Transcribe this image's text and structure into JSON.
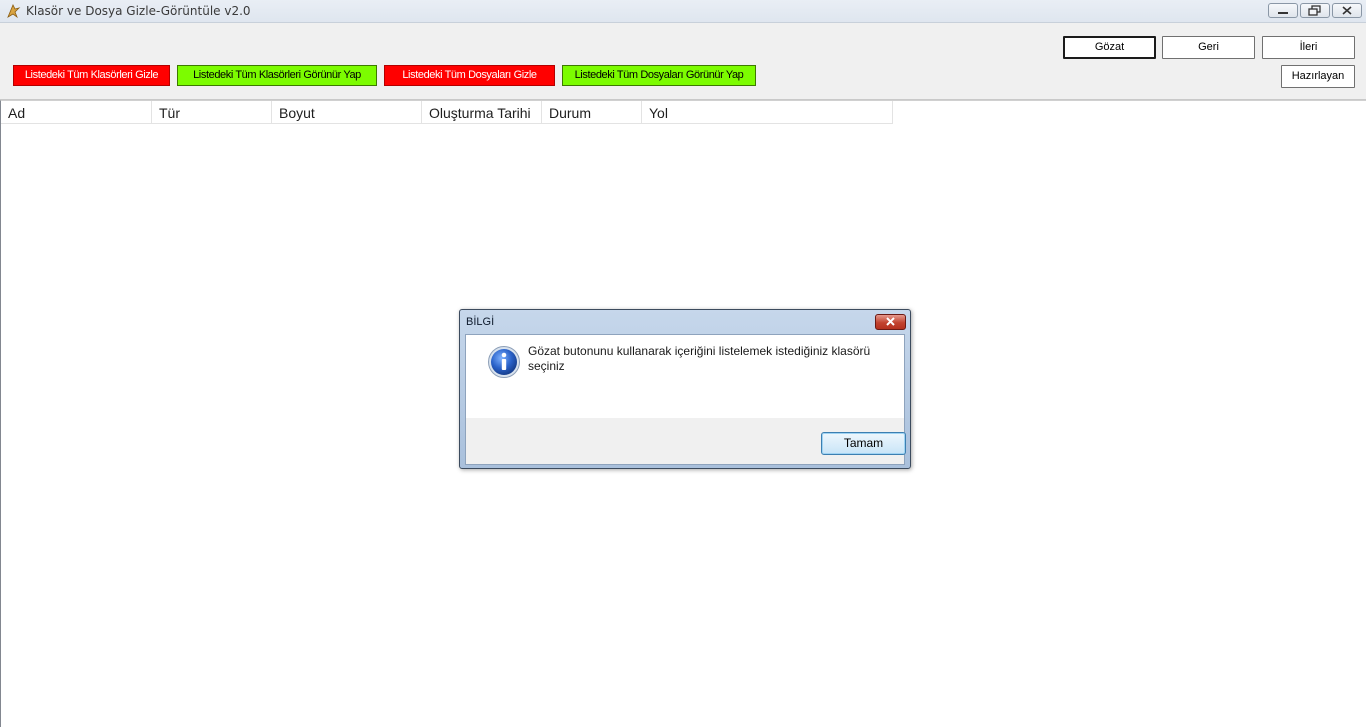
{
  "window": {
    "title": "Klasör ve Dosya Gizle-Görüntüle v2.0"
  },
  "toolbar": {
    "hide_folders": "Listedeki Tüm Klasörleri Gizle",
    "show_folders": "Listedeki Tüm Klasörleri Görünür Yap",
    "hide_files": "Listedeki Tüm Dosyaları Gizle",
    "show_files": "Listedeki Tüm Dosyaları Görünür Yap",
    "browse": "Gözat",
    "back": "Geri",
    "forward": "İleri",
    "author": "Hazırlayan"
  },
  "list": {
    "columns": [
      "Ad",
      "Tür",
      "Boyut",
      "Oluşturma Tarihi",
      "Durum",
      "Yol"
    ]
  },
  "dialog": {
    "title": "BİLGİ",
    "message": "Gözat butonunu kullanarak içeriğini listelemek istediğiniz klasörü seçiniz",
    "ok": "Tamam",
    "icon": "info-icon"
  },
  "colors": {
    "red_button": "#ff0000",
    "green_button": "#7cfc00",
    "dialog_frame": "#a9c0dc"
  }
}
